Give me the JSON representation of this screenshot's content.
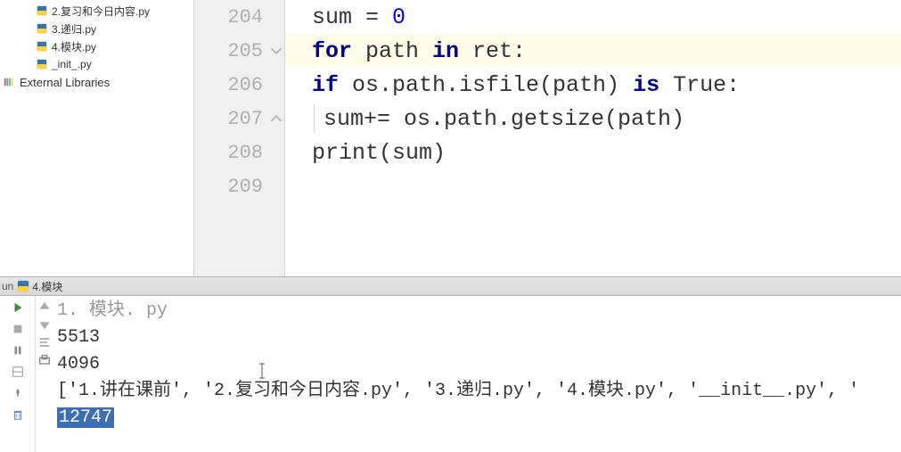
{
  "sidebar": {
    "items": [
      {
        "label": "2.复习和今日内容.py"
      },
      {
        "label": "3.递归.py"
      },
      {
        "label": "4.模块.py"
      },
      {
        "label": "_init_.py"
      }
    ],
    "external_label": "External Libraries"
  },
  "editor": {
    "lines": [
      {
        "num": "204"
      },
      {
        "num": "205"
      },
      {
        "num": "206"
      },
      {
        "num": "207"
      },
      {
        "num": "208"
      },
      {
        "num": "209"
      }
    ],
    "tokens": {
      "l204_pre": "sum = ",
      "l204_num": "0",
      "l205_for": "for",
      "l205_mid": " path ",
      "l205_in": "in",
      "l205_end": " ret:",
      "l206_if": "if",
      "l206_mid": " os.path.isfile(path) ",
      "l206_is": "is",
      "l206_end": " True:",
      "l207_body": "sum+= os.path.getsize(path)",
      "l208_print": "print",
      "l208_arg": "(sum)"
    }
  },
  "run": {
    "tab_label": "4.模块",
    "run_prefix": "un"
  },
  "output": {
    "l0": "1. 模块. py",
    "l1": "5513",
    "l2": "4096",
    "l3": "['1.讲在课前', '2.复习和今日内容.py', '3.递归.py', '4.模块.py', '__init__.py', '",
    "l4_sel": "12747"
  }
}
